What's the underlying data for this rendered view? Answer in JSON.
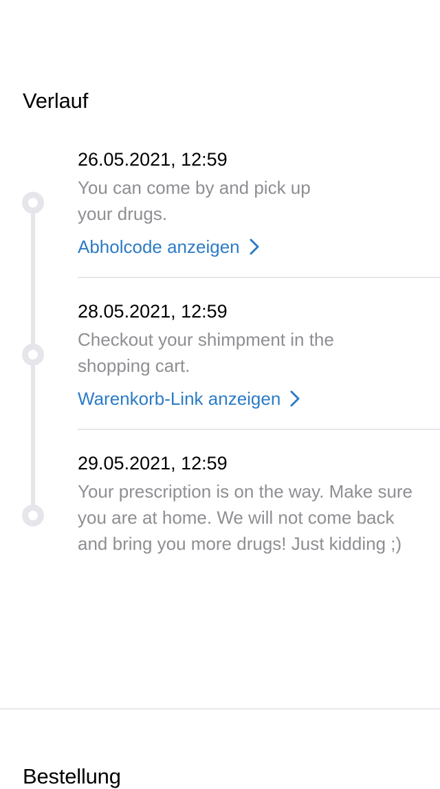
{
  "verlauf": {
    "title": "Verlauf",
    "entries": [
      {
        "date": "26.05.2021, 12:59",
        "text": "You can come by and pick up your drugs.",
        "link": "Abholcode anzeigen"
      },
      {
        "date": "28.05.2021, 12:59",
        "text": "Checkout your shimpment in the shopping cart.",
        "link": "Warenkorb-Link anzeigen"
      },
      {
        "date": "29.05.2021, 12:59",
        "text": "Your prescription is on the way. Make sure you are at home. We will not come back and bring you more drugs! Just kidding ;)"
      }
    ]
  },
  "bestellung": {
    "title": "Bestellung"
  },
  "icons": {
    "timeline_dot": "circle-outline-icon",
    "link_chevron": "chevron-right-icon"
  },
  "colors": {
    "link": "#2c7bc6",
    "secondary_text": "#8e8e93",
    "timeline": "#e5e5ea",
    "divider": "#d1d1d6"
  }
}
